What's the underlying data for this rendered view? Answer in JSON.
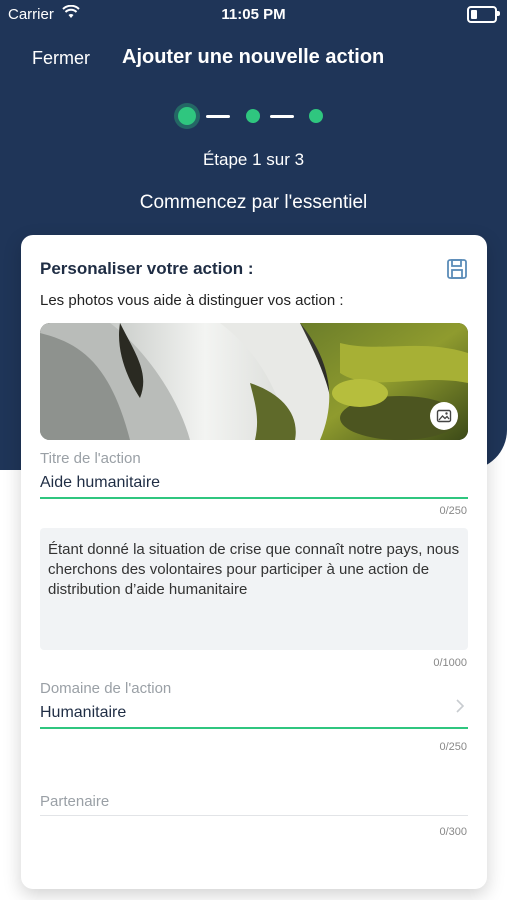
{
  "status_bar": {
    "carrier": "Carrier",
    "time": "11:05 PM"
  },
  "header": {
    "close_label": "Fermer",
    "title": "Ajouter une nouvelle action",
    "step_text": "Étape 1 sur 3",
    "subtitle": "Commencez par l'essentiel"
  },
  "colors": {
    "primary": "#1f3558",
    "accent": "#2fc67f"
  },
  "card": {
    "title": "Personaliser votre action :",
    "photo_label": "Les photos vous aide à distinguer vos action :",
    "fields": {
      "titre": {
        "label": "Titre de l'action",
        "value": "Aide humanitaire",
        "counter": "0/250"
      },
      "description": {
        "value": "Étant donné la situation de crise que connaît notre pays, nous cherchons des volontaires pour participer à une action de distribution d’aide humanitaire",
        "counter": "0/1000"
      },
      "domaine": {
        "label": "Domaine de l'action",
        "value": "Humanitaire",
        "counter": "0/250"
      },
      "partenaire": {
        "placeholder": "Partenaire",
        "counter": "0/300"
      }
    }
  },
  "icons": {
    "save": "floppy-disk-icon",
    "photo_change": "image-edit-icon",
    "chevron": "chevron-right-icon",
    "wifi": "wifi-icon",
    "battery": "battery-icon"
  }
}
